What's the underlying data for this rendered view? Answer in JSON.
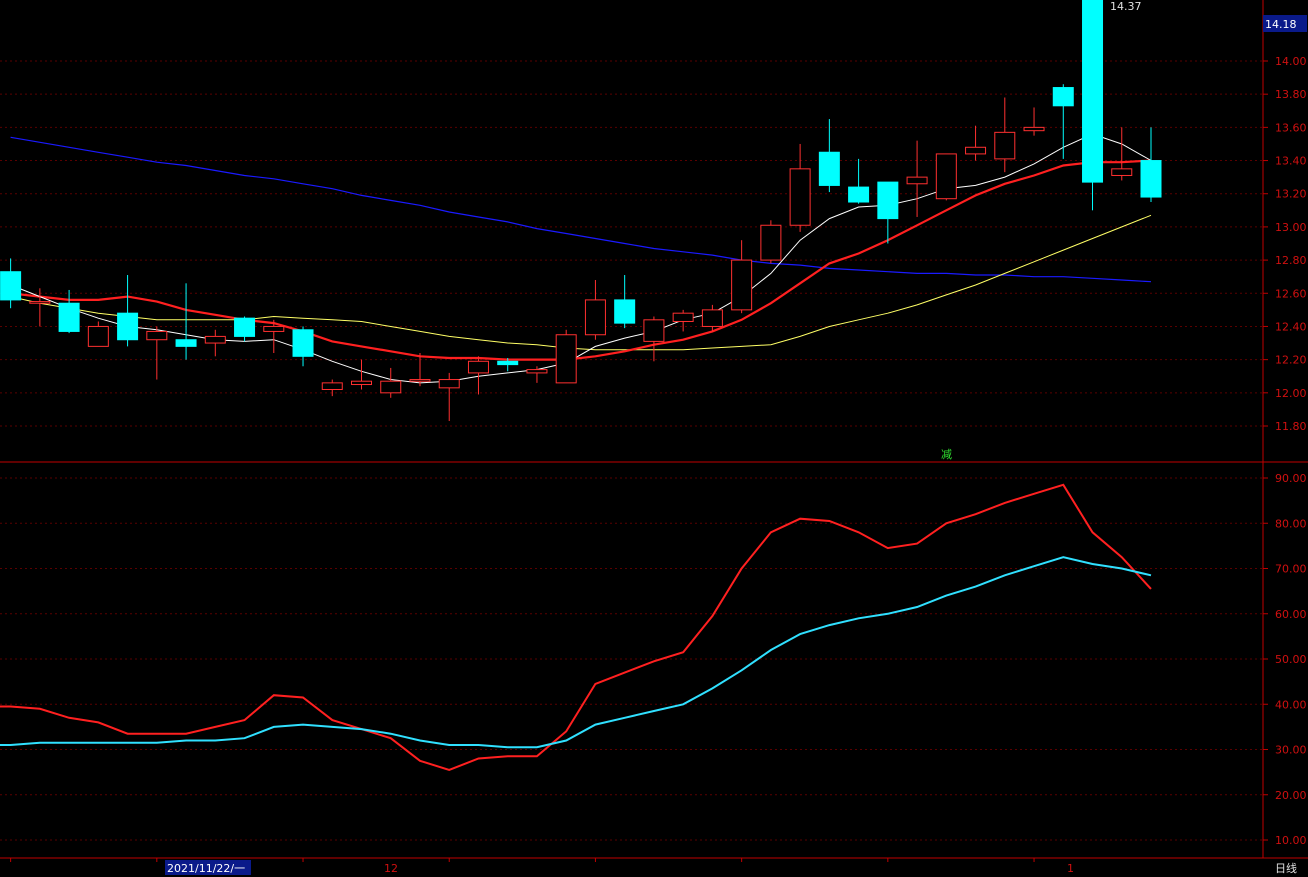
{
  "chart_data": [
    {
      "type": "candlestick",
      "period_label": "日线",
      "price_marker": "14.18",
      "high_label": "14.37",
      "signal_label": "减",
      "y_ticks": [
        "14.00",
        "13.80",
        "13.60",
        "13.40",
        "13.20",
        "13.00",
        "12.80",
        "12.60",
        "12.40",
        "12.20",
        "12.00",
        "11.80"
      ],
      "ylim": [
        11.8,
        14.0
      ],
      "x_labels": [
        "2021/11/22/一",
        "12",
        "1"
      ],
      "colors": {
        "up": "#ff3030",
        "down": "#00ffff",
        "ma_short": "#ffffff",
        "ma_mid": "#ff2020",
        "ma_long": "#ffff66",
        "ma_longest": "#1a1aff",
        "axis": "#c00000"
      },
      "candles": [
        {
          "o": 12.73,
          "h": 12.81,
          "l": 12.51,
          "c": 12.56
        },
        {
          "o": 12.54,
          "h": 12.63,
          "l": 12.4,
          "c": 12.55
        },
        {
          "o": 12.54,
          "h": 12.62,
          "l": 12.36,
          "c": 12.37
        },
        {
          "o": 12.28,
          "h": 12.43,
          "l": 12.28,
          "c": 12.4
        },
        {
          "o": 12.48,
          "h": 12.71,
          "l": 12.28,
          "c": 12.32
        },
        {
          "o": 12.32,
          "h": 12.4,
          "l": 12.08,
          "c": 12.37
        },
        {
          "o": 12.32,
          "h": 12.66,
          "l": 12.2,
          "c": 12.28
        },
        {
          "o": 12.3,
          "h": 12.38,
          "l": 12.22,
          "c": 12.34
        },
        {
          "o": 12.45,
          "h": 12.46,
          "l": 12.31,
          "c": 12.34
        },
        {
          "o": 12.37,
          "h": 12.44,
          "l": 12.24,
          "c": 12.4
        },
        {
          "o": 12.38,
          "h": 12.4,
          "l": 12.16,
          "c": 12.22
        },
        {
          "o": 12.02,
          "h": 12.08,
          "l": 11.98,
          "c": 12.06
        },
        {
          "o": 12.05,
          "h": 12.2,
          "l": 12.02,
          "c": 12.07
        },
        {
          "o": 12.0,
          "h": 12.15,
          "l": 11.97,
          "c": 12.07
        },
        {
          "o": 12.07,
          "h": 12.24,
          "l": 12.04,
          "c": 12.08
        },
        {
          "o": 12.03,
          "h": 12.12,
          "l": 11.83,
          "c": 12.08
        },
        {
          "o": 12.12,
          "h": 12.22,
          "l": 11.99,
          "c": 12.19
        },
        {
          "o": 12.19,
          "h": 12.21,
          "l": 12.13,
          "c": 12.17
        },
        {
          "o": 12.12,
          "h": 12.16,
          "l": 12.06,
          "c": 12.14
        },
        {
          "o": 12.06,
          "h": 12.38,
          "l": 12.06,
          "c": 12.35
        },
        {
          "o": 12.35,
          "h": 12.68,
          "l": 12.32,
          "c": 12.56
        },
        {
          "o": 12.56,
          "h": 12.71,
          "l": 12.39,
          "c": 12.42
        },
        {
          "o": 12.31,
          "h": 12.46,
          "l": 12.19,
          "c": 12.44
        },
        {
          "o": 12.43,
          "h": 12.5,
          "l": 12.37,
          "c": 12.48
        },
        {
          "o": 12.4,
          "h": 12.53,
          "l": 12.37,
          "c": 12.5
        },
        {
          "o": 12.5,
          "h": 12.92,
          "l": 12.48,
          "c": 12.8
        },
        {
          "o": 12.8,
          "h": 13.04,
          "l": 12.78,
          "c": 13.01
        },
        {
          "o": 13.01,
          "h": 13.5,
          "l": 12.97,
          "c": 13.35
        },
        {
          "o": 13.45,
          "h": 13.65,
          "l": 13.21,
          "c": 13.25
        },
        {
          "o": 13.24,
          "h": 13.41,
          "l": 13.14,
          "c": 13.15
        },
        {
          "o": 13.27,
          "h": 13.27,
          "l": 12.9,
          "c": 13.05
        },
        {
          "o": 13.26,
          "h": 13.52,
          "l": 13.06,
          "c": 13.3
        },
        {
          "o": 13.17,
          "h": 13.4,
          "l": 13.16,
          "c": 13.44
        },
        {
          "o": 13.44,
          "h": 13.61,
          "l": 13.4,
          "c": 13.48
        },
        {
          "o": 13.41,
          "h": 13.78,
          "l": 13.33,
          "c": 13.57
        },
        {
          "o": 13.58,
          "h": 13.72,
          "l": 13.55,
          "c": 13.6
        },
        {
          "o": 13.84,
          "h": 13.86,
          "l": 13.41,
          "c": 13.73
        },
        {
          "o": 14.37,
          "h": 14.37,
          "l": 13.1,
          "c": 13.27
        },
        {
          "o": 13.31,
          "h": 13.6,
          "l": 13.28,
          "c": 13.35
        },
        {
          "o": 13.4,
          "h": 13.6,
          "l": 13.15,
          "c": 13.18
        }
      ],
      "ma_short": [
        12.65,
        12.58,
        12.51,
        12.45,
        12.4,
        12.38,
        12.35,
        12.32,
        12.31,
        12.32,
        12.26,
        12.19,
        12.13,
        12.08,
        12.06,
        12.07,
        12.1,
        12.12,
        12.14,
        12.18,
        12.28,
        12.33,
        12.37,
        12.44,
        12.48,
        12.58,
        12.72,
        12.92,
        13.05,
        13.12,
        13.13,
        13.17,
        13.23,
        13.25,
        13.3,
        13.38,
        13.48,
        13.56,
        13.5,
        13.4
      ],
      "ma_mid": [
        12.6,
        12.58,
        12.56,
        12.56,
        12.58,
        12.55,
        12.5,
        12.47,
        12.44,
        12.42,
        12.37,
        12.31,
        12.28,
        12.25,
        12.22,
        12.21,
        12.21,
        12.2,
        12.2,
        12.2,
        12.22,
        12.25,
        12.29,
        12.32,
        12.37,
        12.44,
        12.54,
        12.66,
        12.78,
        12.84,
        12.92,
        13.01,
        13.1,
        13.19,
        13.26,
        13.31,
        13.37,
        13.39,
        13.39,
        13.4
      ],
      "ma_long": [
        12.58,
        12.54,
        12.51,
        12.48,
        12.46,
        12.44,
        12.44,
        12.44,
        12.44,
        12.46,
        12.45,
        12.44,
        12.43,
        12.4,
        12.37,
        12.34,
        12.32,
        12.3,
        12.29,
        12.27,
        12.26,
        12.26,
        12.26,
        12.26,
        12.27,
        12.28,
        12.29,
        12.34,
        12.4,
        12.44,
        12.48,
        12.53,
        12.59,
        12.65,
        12.72,
        12.79,
        12.86,
        12.93,
        13.0,
        13.07
      ],
      "ma_longest": [
        13.54,
        13.51,
        13.48,
        13.45,
        13.42,
        13.39,
        13.37,
        13.34,
        13.31,
        13.29,
        13.26,
        13.23,
        13.19,
        13.16,
        13.13,
        13.09,
        13.06,
        13.03,
        12.99,
        12.96,
        12.93,
        12.9,
        12.87,
        12.85,
        12.83,
        12.8,
        12.78,
        12.77,
        12.75,
        12.74,
        12.73,
        12.72,
        12.72,
        12.71,
        12.71,
        12.7,
        12.7,
        12.69,
        12.68,
        12.67
      ]
    },
    {
      "type": "line",
      "y_ticks": [
        "90.00",
        "80.00",
        "70.00",
        "60.00",
        "50.00",
        "40.00",
        "30.00",
        "20.00",
        "10.00"
      ],
      "ylim": [
        10,
        90
      ],
      "colors": {
        "line_a": "#ff2020",
        "line_b": "#30e0ff",
        "grid": "#5a0000"
      },
      "series": [
        {
          "values": [
            39.5,
            39.0,
            37.0,
            36.0,
            33.5,
            33.5,
            33.5,
            35.0,
            36.5,
            42.0,
            41.5,
            36.5,
            34.5,
            32.5,
            27.5,
            25.5,
            28.0,
            28.5,
            28.5,
            34.0,
            44.5,
            47.0,
            49.5,
            51.5,
            59.5,
            70.0,
            78.0,
            81.0,
            80.5,
            78.0,
            74.5,
            75.5,
            80.0,
            82.0,
            84.5,
            86.5,
            88.5,
            78.0,
            72.5,
            65.5
          ]
        },
        {
          "values": [
            31.0,
            31.5,
            31.5,
            31.5,
            31.5,
            31.5,
            32.0,
            32.0,
            32.5,
            35.0,
            35.5,
            35.0,
            34.5,
            33.5,
            32.0,
            31.0,
            31.0,
            30.5,
            30.5,
            32.0,
            35.5,
            37.0,
            38.5,
            40.0,
            43.5,
            47.5,
            52.0,
            55.5,
            57.5,
            59.0,
            60.0,
            61.5,
            64.0,
            66.0,
            68.5,
            70.5,
            72.5,
            71.0,
            70.0,
            68.5
          ]
        }
      ]
    }
  ]
}
